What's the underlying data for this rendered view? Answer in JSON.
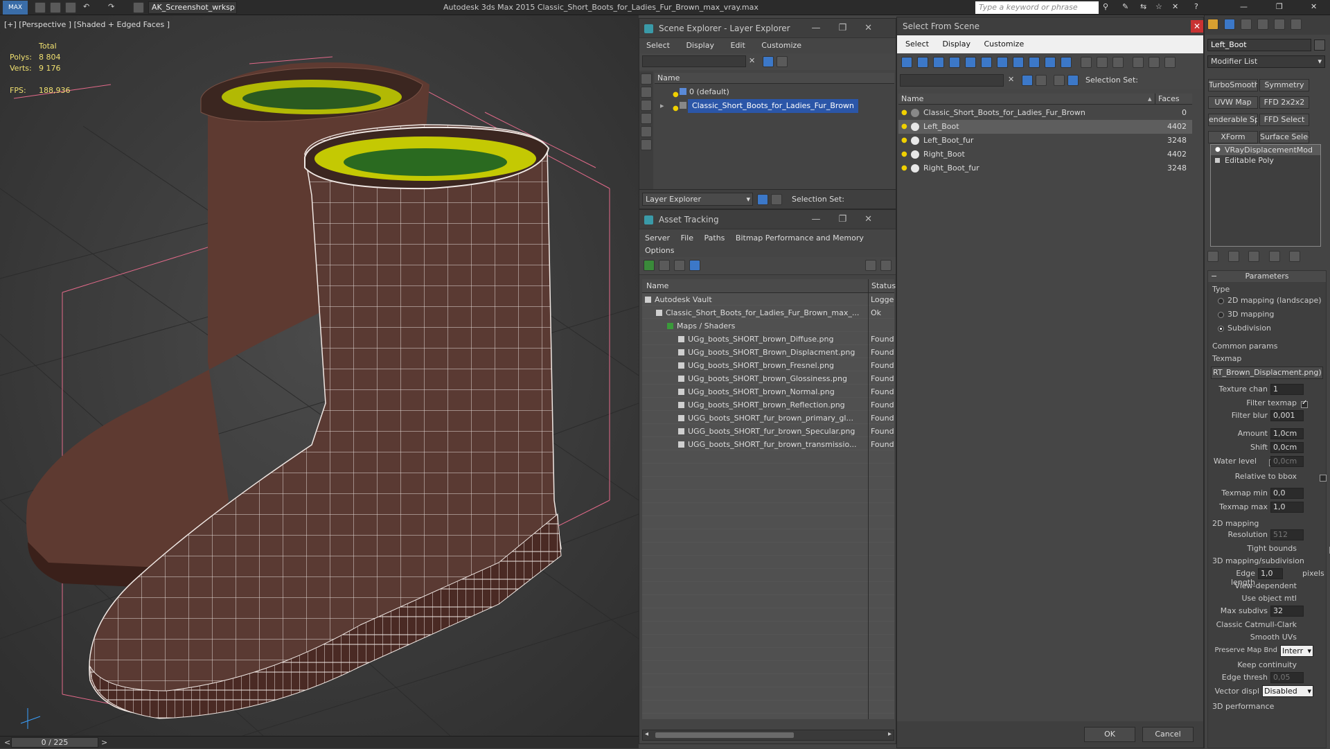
{
  "titlebar": {
    "workspace": "AK_Screenshot_wrksp",
    "title": "Autodesk 3ds Max  2015    Classic_Short_Boots_for_Ladies_Fur_Brown_max_vray.max",
    "search_placeholder": "Type a keyword or phrase"
  },
  "viewport": {
    "label": "[+] [Perspective ] [Shaded + Edged Faces ]",
    "stats_total_label": "Total",
    "polys_label": "Polys:",
    "polys_value": "8 804",
    "verts_label": "Verts:",
    "verts_value": "9 176",
    "fps_label": "FPS:",
    "fps_value": "188,936"
  },
  "timeline": {
    "prev": "<",
    "frame": "0 / 225",
    "next": ">"
  },
  "scene_explorer": {
    "title": "Scene Explorer - Layer Explorer",
    "menu": [
      "Select",
      "Display",
      "Edit",
      "Customize"
    ],
    "col_name": "Name",
    "rows": [
      "0 (default)",
      "Classic_Short_Boots_for_Ladies_Fur_Brown"
    ],
    "footer_dropdown": "Layer Explorer",
    "selection_set_label": "Selection Set:"
  },
  "asset_tracking": {
    "title": "Asset Tracking",
    "menu": [
      "Server",
      "File",
      "Paths",
      "Bitmap Performance and Memory",
      "Options"
    ],
    "col_name": "Name",
    "col_status": "Status",
    "rows": [
      {
        "name": "Autodesk Vault",
        "status": "Logge"
      },
      {
        "name": "Classic_Short_Boots_for_Ladies_Fur_Brown_max_...",
        "status": "Ok"
      },
      {
        "name": "Maps / Shaders",
        "status": ""
      },
      {
        "name": "UGg_boots_SHORT_brown_Diffuse.png",
        "status": "Found"
      },
      {
        "name": "UGg_boots_SHORT_Brown_Displacment.png",
        "status": "Found"
      },
      {
        "name": "UGg_boots_SHORT_brown_Fresnel.png",
        "status": "Found"
      },
      {
        "name": "UGg_boots_SHORT_brown_Glossiness.png",
        "status": "Found"
      },
      {
        "name": "UGg_boots_SHORT_brown_Normal.png",
        "status": "Found"
      },
      {
        "name": "UGg_boots_SHORT_brown_Reflection.png",
        "status": "Found"
      },
      {
        "name": "UGG_boots_SHORT_fur_brown_primary_gl...",
        "status": "Found"
      },
      {
        "name": "UGG_boots_SHORT_fur_brown_Specular.png",
        "status": "Found"
      },
      {
        "name": "UGG_boots_SHORT_fur_brown_transmissio...",
        "status": "Found"
      }
    ]
  },
  "select_from_scene": {
    "title": "Select From Scene",
    "menu": [
      "Select",
      "Display",
      "Customize"
    ],
    "selection_set_label": "Selection Set:",
    "col_name": "Name",
    "col_faces": "Faces",
    "rows": [
      {
        "name": "Classic_Short_Boots_for_Ladies_Fur_Brown",
        "faces": "0"
      },
      {
        "name": "Left_Boot",
        "faces": "4402"
      },
      {
        "name": "Left_Boot_fur",
        "faces": "3248"
      },
      {
        "name": "Right_Boot",
        "faces": "4402"
      },
      {
        "name": "Right_Boot_fur",
        "faces": "3248"
      }
    ],
    "ok": "OK",
    "cancel": "Cancel"
  },
  "command_panel": {
    "object_name": "Left_Boot",
    "modifier_list": "Modifier List",
    "mod_buttons": [
      "TurboSmooth",
      "Symmetry",
      "UVW Map",
      "FFD 2x2x2",
      "enderable Spli",
      "FFD Select",
      "XForm",
      "Surface Select"
    ],
    "stack": [
      "VRayDisplacementMod",
      "Editable Poly"
    ],
    "parameters_title": "Parameters",
    "type_label": "Type",
    "type_options": [
      "2D mapping (landscape)",
      "3D mapping",
      "Subdivision"
    ],
    "common_params": "Common params",
    "texmap_label": "Texmap",
    "texmap_value": "RT_Brown_Displacment.png)",
    "texture_chan_label": "Texture chan",
    "texture_chan_value": "1",
    "filter_texmap_label": "Filter texmap",
    "filter_blur_label": "Filter blur",
    "filter_blur_value": "0,001",
    "amount_label": "Amount",
    "amount_value": "1,0cm",
    "shift_label": "Shift",
    "shift_value": "0,0cm",
    "water_level_label": "Water level",
    "water_level_value": "0,0cm",
    "relative_bbox_label": "Relative to bbox",
    "texmap_min_label": "Texmap min",
    "texmap_min_value": "0,0",
    "texmap_max_label": "Texmap max",
    "texmap_max_value": "1,0",
    "mapping2d": "2D mapping",
    "resolution_label": "Resolution",
    "resolution_value": "512",
    "tight_bounds_label": "Tight bounds",
    "mapping3d": "3D mapping/subdivision",
    "edge_length_label": "Edge length",
    "edge_length_value": "1,0",
    "pixels_label": "pixels",
    "view_dependent_label": "View-dependent",
    "use_object_mtl_label": "Use object mtl",
    "max_subdivs_label": "Max subdivs",
    "max_subdivs_value": "32",
    "classic_catmull_label": "Classic Catmull-Clark",
    "smooth_uvs_label": "Smooth UVs",
    "preserve_map_label": "Preserve Map Bnd",
    "preserve_map_value": "Interr",
    "keep_continuity_label": "Keep continuity",
    "edge_thresh_label": "Edge thresh",
    "edge_thresh_value": "0,05",
    "vector_displ_label": "Vector displ",
    "vector_displ_value": "Disabled",
    "performance_label": "3D performance"
  }
}
